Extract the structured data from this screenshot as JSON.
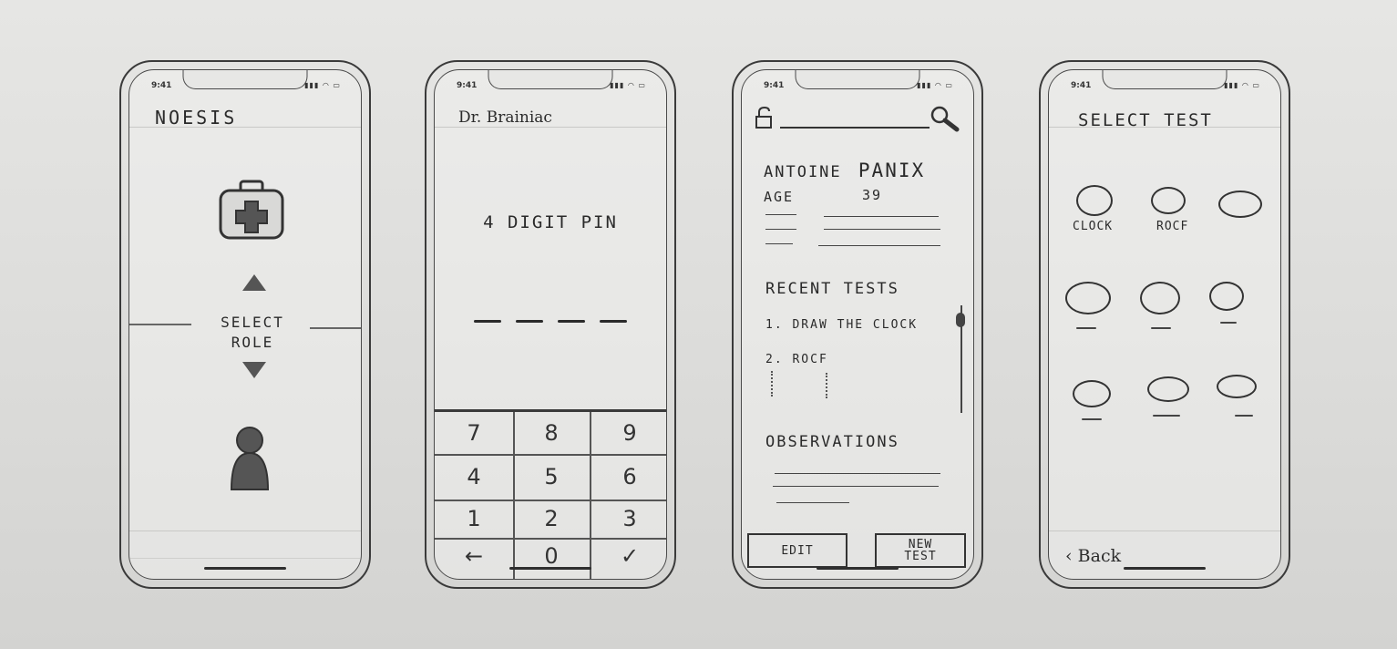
{
  "status_bar": {
    "time": "9:41"
  },
  "role_screen": {
    "app_title": "NOESIS",
    "select_label_line1": "SELECT",
    "select_label_line2": "ROLE",
    "icons": [
      "medical-kit-icon",
      "person-icon"
    ]
  },
  "pin_screen": {
    "user_name": "Dr. Brainiac",
    "prompt": "4 DIGIT PIN",
    "keys": [
      "7",
      "8",
      "9",
      "4",
      "5",
      "6",
      "1",
      "2",
      "3",
      "←",
      "0",
      "✓"
    ]
  },
  "patient_screen": {
    "patient_name_first": "ANTOINE",
    "patient_name_last": "PANIX",
    "age_label": "AGE",
    "age_value": "39",
    "recent_tests_heading": "RECENT TESTS",
    "recent_tests": [
      "1. DRAW THE CLOCK",
      "2. ROCF"
    ],
    "observations_heading": "OBSERVATIONS",
    "edit_button": "EDIT",
    "new_test_button_line1": "NEW",
    "new_test_button_line2": "TEST"
  },
  "select_test_screen": {
    "heading": "SELECT TEST",
    "tests": [
      "CLOCK",
      "ROCF"
    ],
    "back_label": "Back"
  }
}
